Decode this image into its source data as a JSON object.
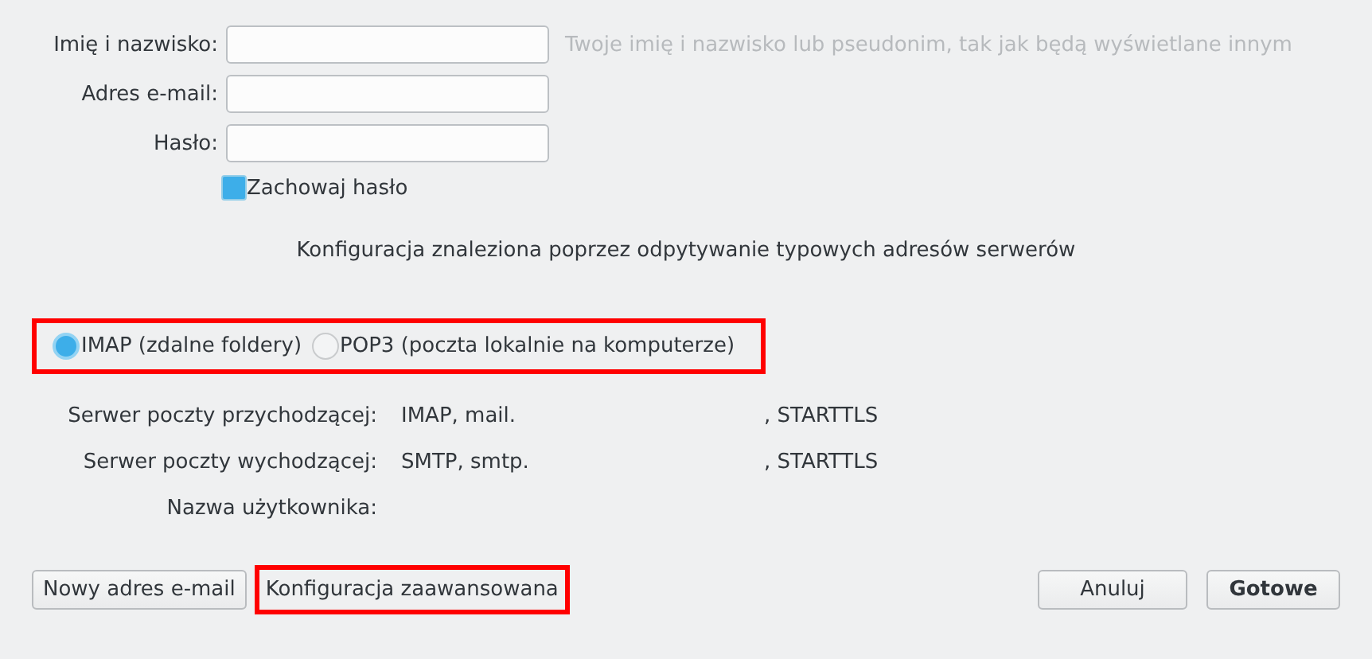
{
  "identity_fields": [
    {
      "label": "Imię i nazwisko:",
      "hint": "Twoje imię i nazwisko lub pseudonim, tak jak będą wyświetlane innym"
    },
    {
      "label": "Adres e-mail:"
    },
    {
      "label": "Hasło:"
    }
  ],
  "remember_password": {
    "label": "Zachowaj hasło",
    "checked": true
  },
  "status_message": "Konfiguracja znaleziona poprzez odpytywanie typowych adresów serwerów",
  "protocol_options": {
    "highlighted": true,
    "options": [
      {
        "label": "IMAP (zdalne foldery)",
        "selected": true
      },
      {
        "label": "POP3 (poczta lokalnie na komputerze)",
        "selected": false
      }
    ]
  },
  "server_details": [
    {
      "label": "Serwer poczty przychodzącej:",
      "value": "IMAP, mail.",
      "security": ", STARTTLS"
    },
    {
      "label": "Serwer poczty wychodzącej:",
      "value": "SMTP, smtp.",
      "security": ", STARTTLS"
    },
    {
      "label": "Nazwa użytkownika:"
    }
  ],
  "left_buttons": [
    {
      "label": "Nowy adres e-mail",
      "highlighted": false
    },
    {
      "label": "Konfiguracja zaawansowana",
      "highlighted": true
    }
  ],
  "right_buttons": [
    {
      "label": "Anuluj",
      "default": false
    },
    {
      "label": "Gotowe",
      "default": true
    }
  ]
}
